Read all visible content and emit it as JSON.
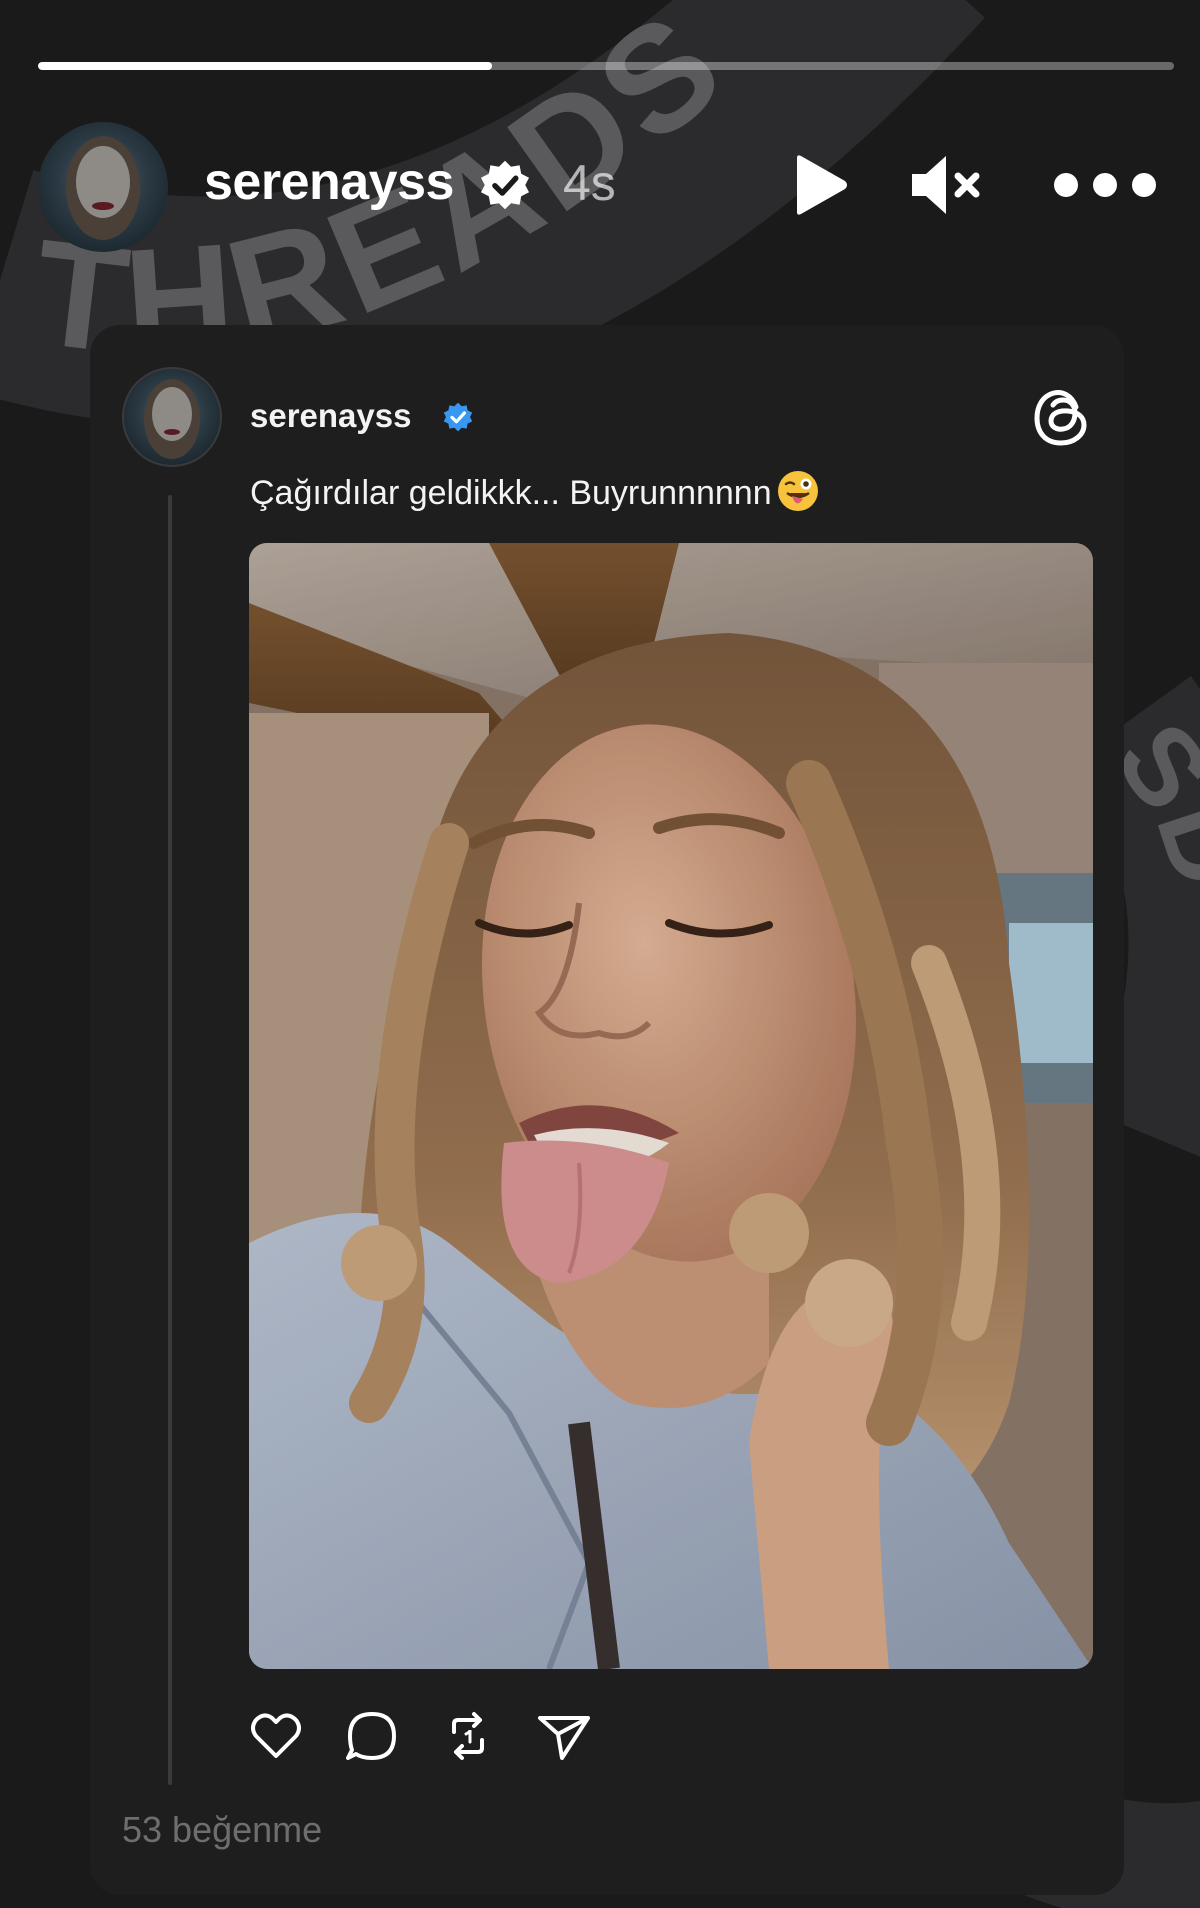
{
  "story": {
    "progress_fraction": 0.4,
    "username": "serenayss",
    "time_ago": "4s",
    "background_watermark": "THREADS"
  },
  "icons": {
    "verified": "verified-badge-icon",
    "play": "play-icon",
    "mute": "speaker-muted-icon",
    "more": "more-horizontal-icon",
    "threads": "threads-logo-icon",
    "like": "heart-icon",
    "comment": "comment-icon",
    "repost": "repost-icon",
    "share": "send-icon"
  },
  "post": {
    "username": "serenayss",
    "caption": "Çağırdılar geldikkk... Buyrunnnnnn",
    "likes": "53 beğenme"
  },
  "colors": {
    "verified_blue": "#3897f0",
    "background": "#1a1a1b",
    "card": "#1e1e1f"
  }
}
